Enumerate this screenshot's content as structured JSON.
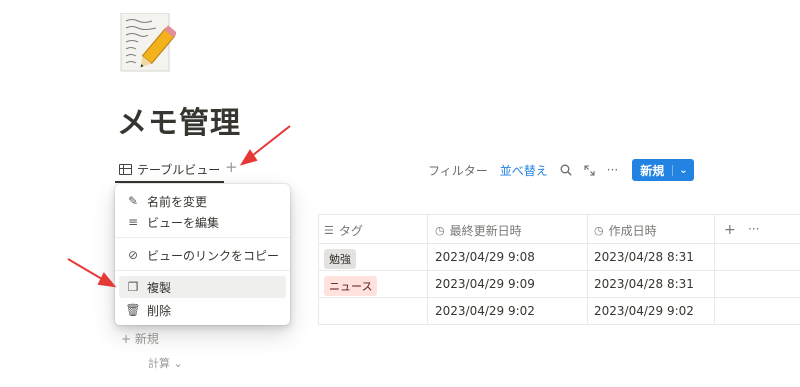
{
  "page": {
    "title": "メモ管理"
  },
  "view": {
    "tab_label": "テーブルビュー",
    "add_symbol": "+"
  },
  "toolbar": {
    "filter": "フィルター",
    "sort": "並べ替え",
    "search_icon": "search-icon",
    "expand_icon": "expand-icon",
    "more": "···",
    "new": "新規",
    "new_caret": "⌄"
  },
  "context_menu": {
    "items": [
      {
        "icon": "edit-icon",
        "glyph": "✎",
        "label": "名前を変更"
      },
      {
        "icon": "sliders-icon",
        "glyph": "≡",
        "label": "ビューを編集"
      },
      {
        "icon": "link-icon",
        "glyph": "⊘",
        "label": "ビューのリンクをコピー"
      },
      {
        "icon": "duplicate-icon",
        "glyph": "❐",
        "label": "複製"
      },
      {
        "icon": "trash-icon",
        "glyph": "🗑",
        "label": "削除"
      }
    ]
  },
  "table": {
    "columns": [
      {
        "icon": "☰",
        "label": "タグ"
      },
      {
        "icon": "◷",
        "label": "最終更新日時"
      },
      {
        "icon": "◷",
        "label": "作成日時"
      }
    ],
    "header_actions": {
      "add": "+",
      "more": "···"
    },
    "rows": [
      {
        "tag": "勉強",
        "tag_color": "#e3e2e0",
        "updated": "2023/04/29 9:08",
        "created": "2023/04/28 8:31"
      },
      {
        "tag": "ニュース",
        "tag_color": "#ffe2dd",
        "updated": "2023/04/29 9:09",
        "created": "2023/04/28 8:31"
      },
      {
        "tag": "",
        "updated": "2023/04/29 9:02",
        "created": "2023/04/29 9:02"
      }
    ],
    "new_row": "+ 新規",
    "calculate": "計算 ⌄"
  },
  "colors": {
    "accent": "#2383e2",
    "annotation_arrow": "#e53935"
  }
}
